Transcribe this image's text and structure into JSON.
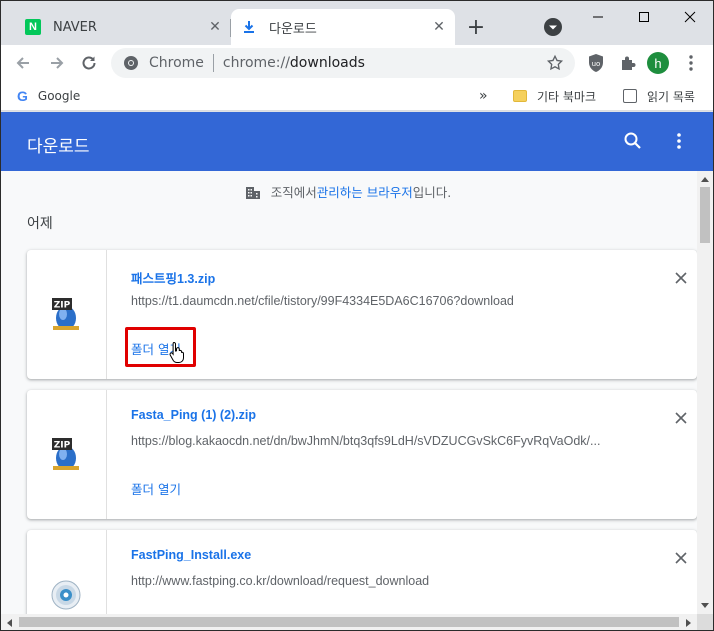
{
  "tabs": [
    {
      "label": "NAVER",
      "favicon": "naver-icon",
      "favicon_text": "N",
      "active": false
    },
    {
      "label": "다운로드",
      "favicon": "download-icon",
      "active": true
    }
  ],
  "omnibox": {
    "scheme_label": "Chrome",
    "url_prefix": "chrome://",
    "url_host": "downloads"
  },
  "profile": {
    "initial": "h",
    "color": "#1e8e3e"
  },
  "bookmarks": {
    "google_label": "Google",
    "more_label": "»",
    "folder_label": "기타 북마크",
    "reading_list_label": "읽기 목록"
  },
  "downloads_page": {
    "title": "다운로드",
    "managed_notice_prefix": "조직에서 ",
    "managed_notice_link": "관리하는 브라우저",
    "managed_notice_suffix": "입니다.",
    "date_group": "어제",
    "items": [
      {
        "filename": "패스트핑1.3.zip",
        "url": "https://t1.daumcdn.net/cfile/tistory/99F4334E5DA6C16706?download",
        "action": "폴더 열기",
        "icon": "zip-file-icon",
        "icon_text": "ZIP"
      },
      {
        "filename": "Fasta_Ping (1) (2).zip",
        "url": "https://blog.kakaocdn.net/dn/bwJhmN/btq3qfs9LdH/sVDZUCGvSkC6FyvRqVaOdk/...",
        "action": "폴더 열기",
        "icon": "zip-file-icon",
        "icon_text": "ZIP"
      },
      {
        "filename": "FastPing_Install.exe",
        "url": "http://www.fastping.co.kr/download/request_download",
        "action": "",
        "icon": "installer-disc-icon"
      }
    ]
  },
  "colors": {
    "header_blue": "#3367d6",
    "link_blue": "#1a73e8",
    "highlight_red": "#e00000"
  }
}
